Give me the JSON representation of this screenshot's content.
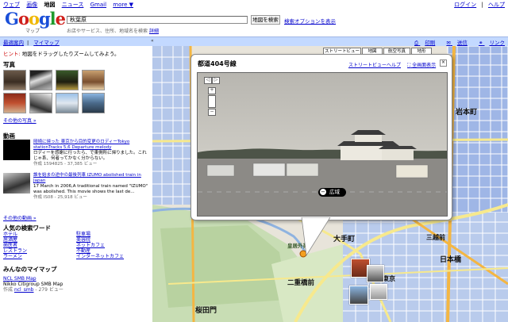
{
  "topbar": {
    "links": [
      "ウェブ",
      "画像",
      "地図",
      "ニュース",
      "Gmail",
      "more ▼"
    ],
    "current_index": 2,
    "right_links": [
      "ログイン",
      "ヘルプ"
    ]
  },
  "logo": {
    "word": "Google",
    "sub": "マップ"
  },
  "search": {
    "value": "秋葉原",
    "button": "地図を検索",
    "options": "検索オプションを表示",
    "hint": "お店やサービス、住所、地域名を検索",
    "hint_link": "詳細"
  },
  "bluebar": {
    "left": [
      "最適案内",
      "マイマップ"
    ],
    "right": [
      "印刷",
      "送信",
      "リンク"
    ]
  },
  "panel": {
    "notice_pink": "ヒント:",
    "notice": "地図をドラッグしたりズームしてみよう。",
    "photos_header": "写真",
    "photos_more": "その他の写真 »",
    "video_header": "動画",
    "videos": [
      {
        "title": "岡崎に帰った 東京から目的変更のロディーTokyo stationTracks 5,6 Departure melody",
        "desc": "ロディーを感謝に行ったら、で東側所に帰りました。これじゃ系、何者ってかなく分からない。",
        "meta": "作成 1594825 - 37,385 ビュー"
      },
      {
        "title": "誰を始まの途中の最後列車 IZUMO abolished train in Japan",
        "desc": "17 March in 2006,A traditional train named \"IZUMO\" was abolished.  This movie shows the last de...",
        "meta": "作成 IS08 - 25,918 ビュー"
      }
    ],
    "videos_more": "その他の動画 »",
    "popular_header": "人気の検索ワード",
    "popular_col1": [
      "ホテル",
      "居酒屋",
      "歯医者",
      "レストラン",
      "ラーメン"
    ],
    "popular_col2": [
      "駐車場",
      "美容院",
      "ネットカフェ",
      "不動産",
      "インターネットカフェ"
    ],
    "mymaps_header": "みんなのマイマップ",
    "mymap_title": "NCL SMB Map",
    "mymap_desc": "Nikko Citigroup SMB Map",
    "mymap_meta_prefix": "作成",
    "mymap_author": "ncl_smb",
    "mymap_views": "- 279 ビュー"
  },
  "map": {
    "controls_top": [
      "ストリートビュー",
      "地図",
      "航空写真",
      "地形"
    ],
    "labels": [
      "岩本町",
      "大手町",
      "三越前",
      "日本橋",
      "二重橋前",
      "桜田門",
      "皇居外苑",
      "東京"
    ],
    "bubble": {
      "title": "都道404号線",
      "link": "ストリートビューヘルプ",
      "full": "全画面表示",
      "zoom": "広域"
    }
  },
  "colors": {
    "link": "#0000cc",
    "bluebar": "#c3d9ff",
    "map_green": "#c8ddb4",
    "road_yellow": "#f7e98d",
    "road_orange": "#f4b642"
  }
}
